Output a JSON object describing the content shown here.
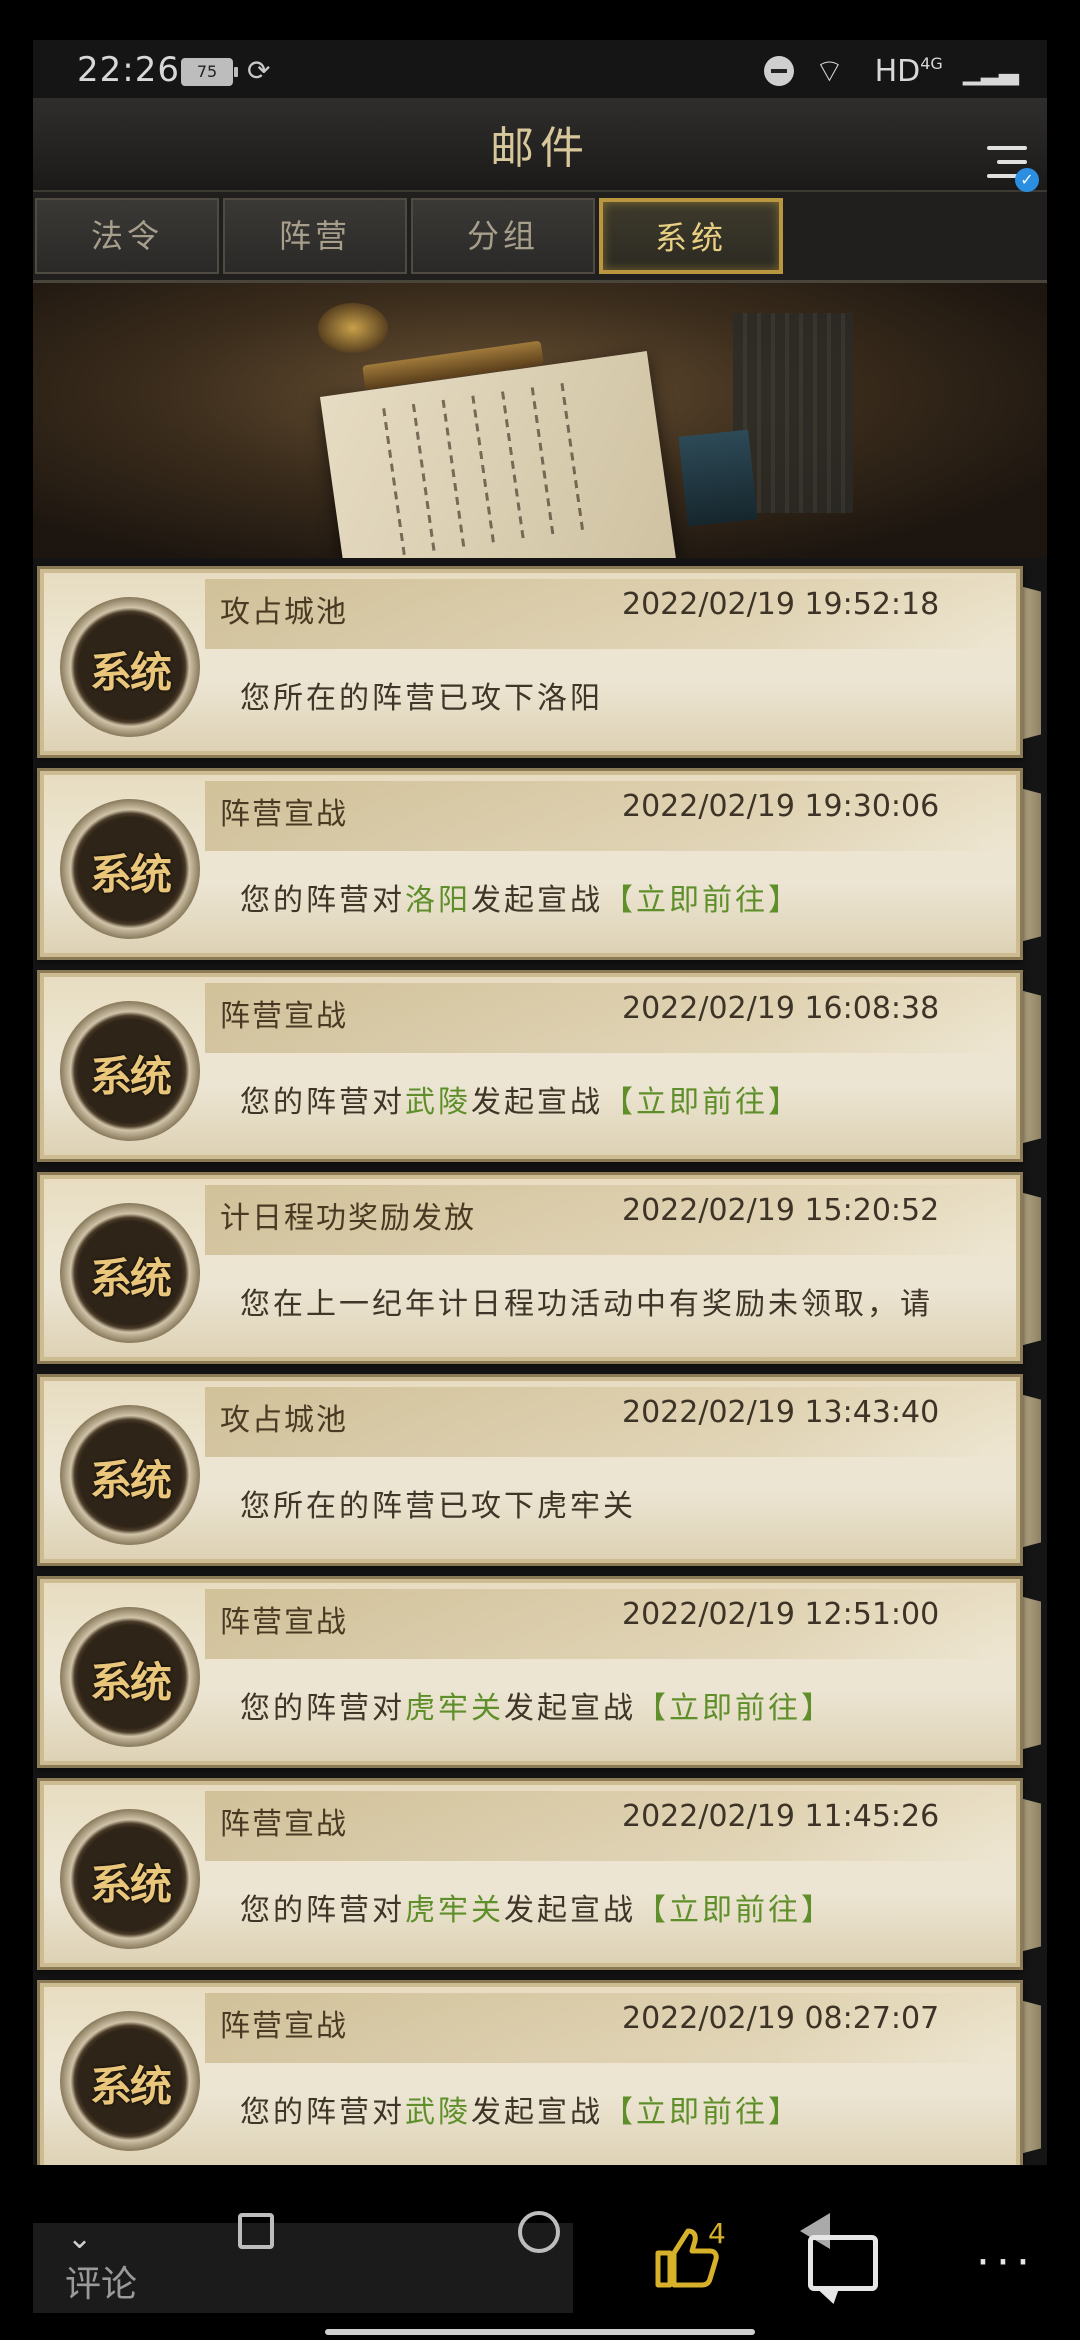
{
  "status_bar": {
    "time": "22:26",
    "battery": "75",
    "network": "HD",
    "network_gen": "4G"
  },
  "header": {
    "title": "邮件"
  },
  "tabs": [
    {
      "label": "法令",
      "active": false
    },
    {
      "label": "阵营",
      "active": false
    },
    {
      "label": "分组",
      "active": false
    },
    {
      "label": "系统",
      "active": true
    }
  ],
  "emblem_text": "系统",
  "mails": [
    {
      "subject": "攻占城池",
      "date": "2022/02/19 19:52:18",
      "body_pre": "您所在的阵营已攻下洛阳",
      "body_place": "",
      "body_mid": "",
      "body_link": ""
    },
    {
      "subject": "阵营宣战",
      "date": "2022/02/19 19:30:06",
      "body_pre": "您的阵营对",
      "body_place": "洛阳",
      "body_mid": "发起宣战",
      "body_link": "【立即前往】"
    },
    {
      "subject": "阵营宣战",
      "date": "2022/02/19 16:08:38",
      "body_pre": "您的阵营对",
      "body_place": "武陵",
      "body_mid": "发起宣战",
      "body_link": "【立即前往】"
    },
    {
      "subject": "计日程功奖励发放",
      "date": "2022/02/19 15:20:52",
      "body_pre": "您在上一纪年计日程功活动中有奖励未领取，请",
      "body_place": "",
      "body_mid": "",
      "body_link": ""
    },
    {
      "subject": "攻占城池",
      "date": "2022/02/19 13:43:40",
      "body_pre": "您所在的阵营已攻下虎牢关",
      "body_place": "",
      "body_mid": "",
      "body_link": ""
    },
    {
      "subject": "阵营宣战",
      "date": "2022/02/19 12:51:00",
      "body_pre": "您的阵营对",
      "body_place": "虎牢关",
      "body_mid": "发起宣战",
      "body_link": "【立即前往】"
    },
    {
      "subject": "阵营宣战",
      "date": "2022/02/19 11:45:26",
      "body_pre": "您的阵营对",
      "body_place": "虎牢关",
      "body_mid": "发起宣战",
      "body_link": "【立即前往】"
    },
    {
      "subject": "阵营宣战",
      "date": "2022/02/19 08:27:07",
      "body_pre": "您的阵营对",
      "body_place": "武陵",
      "body_mid": "发起宣战",
      "body_link": "【立即前往】"
    }
  ],
  "bottom_bar": {
    "comment_label": "评论",
    "like_count": "4"
  },
  "colors": {
    "accent_gold": "#b8973e",
    "link_green": "#5f8f2a",
    "like_yellow": "#d8b12a"
  }
}
